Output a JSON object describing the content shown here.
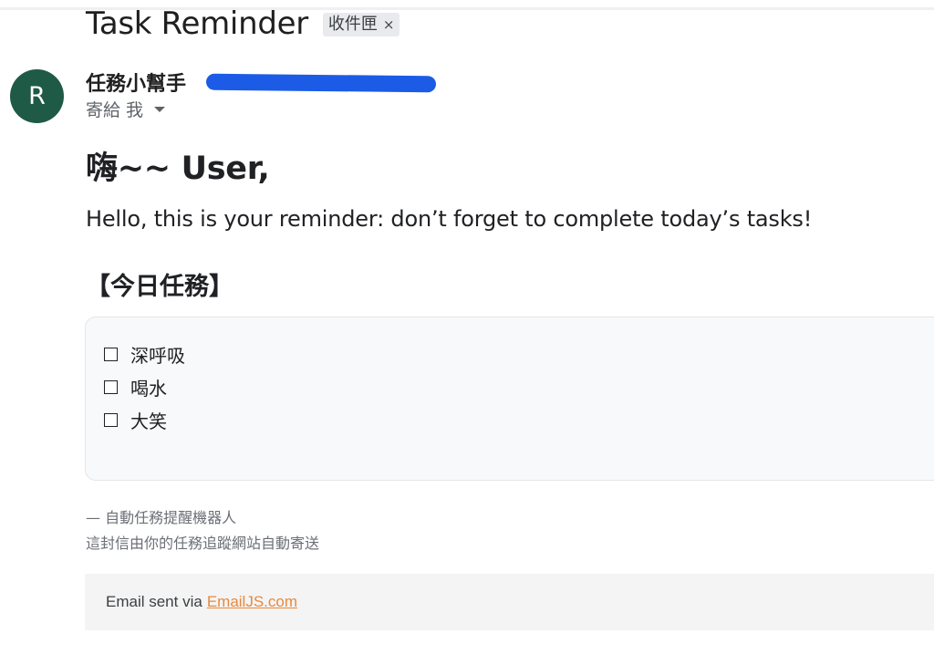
{
  "email": {
    "subject": "Task Reminder",
    "label_chip": "收件匣",
    "label_close": "×",
    "sender": {
      "avatar_letter": "R",
      "name": "任務小幫手",
      "email_redacted": "",
      "to_text": "寄給 我"
    },
    "body": {
      "greeting": "嗨~~ User,",
      "intro": "Hello, this is your reminder: don’t forget to complete today’s tasks!",
      "section_title": "【今日任務】",
      "tasks": [
        {
          "label": "深呼吸",
          "checked": false
        },
        {
          "label": "喝水",
          "checked": false
        },
        {
          "label": "大笑",
          "checked": false
        }
      ],
      "signature_line1": "— 自動任務提醒機器人",
      "signature_line2": "這封信由你的任務追蹤網站自動寄送"
    },
    "footer": {
      "prefix": "Email sent via",
      "link_text": "EmailJS.com"
    }
  },
  "colors": {
    "avatar_bg": "#1f5a46",
    "redaction": "#1c5be6",
    "link": "#e8893c",
    "task_box_bg": "#f8f9fb",
    "footer_bg": "#f4f4f4"
  },
  "icons": [
    "chevron-down-icon",
    "close-icon",
    "checkbox-icon"
  ]
}
